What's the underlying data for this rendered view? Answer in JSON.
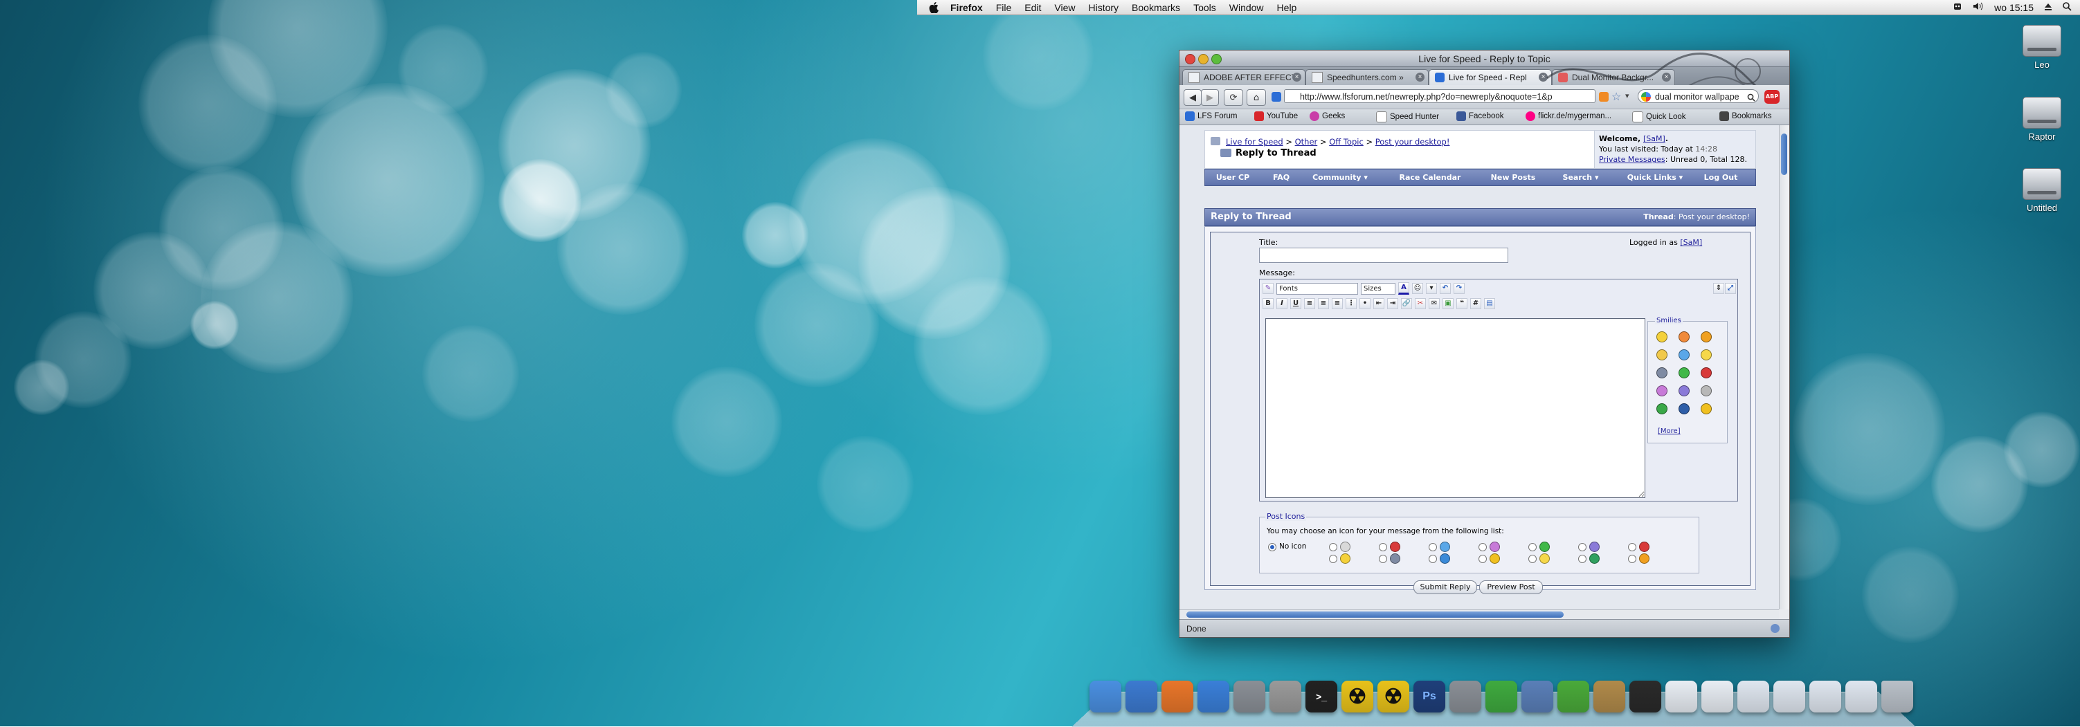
{
  "menubar": {
    "apple_icon": "apple-logo-icon",
    "app_name": "Firefox",
    "items": [
      "File",
      "Edit",
      "View",
      "History",
      "Bookmarks",
      "Tools",
      "Window",
      "Help"
    ],
    "clock": "wo 15:15"
  },
  "desktop_icons": [
    {
      "label": "Leo",
      "icon": "hard-drive-icon"
    },
    {
      "label": "Raptor",
      "icon": "hard-drive-icon"
    },
    {
      "label": "Untitled",
      "icon": "hard-drive-icon"
    }
  ],
  "window": {
    "title": "Live for Speed - Reply to Topic",
    "tabs": [
      {
        "label": "ADOBE AFTER EFFECT",
        "active": false,
        "icon": "page-icon"
      },
      {
        "label": "Speedhunters.com »",
        "active": false,
        "icon": "page-icon"
      },
      {
        "label": "Live for Speed - Repl",
        "active": true,
        "icon": "lfs-icon"
      },
      {
        "label": "Dual Monitor Backgr...",
        "active": false,
        "icon": "page-icon"
      }
    ],
    "url": "http://www.lfsforum.net/newreply.php?do=newreply&noquote=1&p",
    "search_value": "dual monitor wallpape",
    "bookmarks": [
      {
        "label": "LFS Forum",
        "icon": "lfs-icon",
        "color": "#2b6dd6"
      },
      {
        "label": "YouTube",
        "icon": "youtube-icon",
        "color": "#d8262a"
      },
      {
        "label": "Geeks",
        "icon": "geeks-icon",
        "color": "#c93ea8"
      },
      {
        "label": "Speed Hunter",
        "icon": "page-icon",
        "color": "#ffffff"
      },
      {
        "label": "Facebook",
        "icon": "facebook-icon",
        "color": "#3b5998"
      },
      {
        "label": "flickr.de/mygerman...",
        "icon": "flickr-icon",
        "color": "#ff0084"
      },
      {
        "label": "Quick Look",
        "icon": "page-icon",
        "color": "#ffffff"
      },
      {
        "label": "Bookmarks",
        "icon": "bookmarks-icon",
        "color": "#444444"
      }
    ],
    "status": "Done"
  },
  "forum": {
    "breadcrumb": [
      "Live for Speed",
      "Other",
      "Off Topic",
      "Post your desktop!"
    ],
    "page_title": "Reply to Thread",
    "welcome_prefix": "Welcome, ",
    "welcome_user": "[SaM]",
    "welcome_suffix": ".",
    "last_visited_label": "You last visited: Today at ",
    "last_visited_time": "14:28",
    "pm_label": "Private Messages",
    "pm_counts": ": Unread 0, Total 128.",
    "nav": [
      "User CP",
      "FAQ",
      "Community ▾",
      "Race Calendar",
      "New Posts",
      "Search ▾",
      "Quick Links ▾",
      "Log Out"
    ],
    "reply_header": "Reply to Thread",
    "thread_label": "Thread",
    "thread_title": ": Post your desktop!",
    "title_label": "Title:",
    "logged_in_label": "Logged in as ",
    "logged_in_user": "[SaM]",
    "message_label": "Message:",
    "title_value": "",
    "editor": {
      "fonts_label": "Fonts",
      "sizes_label": "Sizes",
      "bold": "B",
      "italic": "I",
      "underline": "U",
      "hash": "#"
    },
    "smilies_label": "Smilies",
    "smilies_more": "[More]",
    "smilie_colors": [
      "#f4d13a",
      "#f08a3a",
      "#f0a020",
      "#f1c94a",
      "#5aa7e8",
      "#f6d84a",
      "#7f8ba3",
      "#40b848",
      "#d83a3a",
      "#c77ad8",
      "#8a7ad8",
      "#b8b8b8",
      "#3aa848",
      "#2e5ea8",
      "#f0c020"
    ],
    "post_icons_label": "Post Icons",
    "post_icons_help": "You may choose an icon for your message from the following list:",
    "no_icon_label": "No icon",
    "post_icon_colors": [
      "#d9d9d9",
      "#d83a3a",
      "#5aa7e8",
      "#c77ad8",
      "#40b848",
      "#8a7ad8",
      "#d83a3a",
      "#f4d13a",
      "#7f8ba3",
      "#3a8ad8",
      "#f0c020",
      "#f6d84a",
      "#30a060",
      "#f0a020"
    ],
    "submit_label": "Submit Reply",
    "preview_label": "Preview Post"
  },
  "dock": {
    "items": [
      {
        "name": "finder-icon",
        "color": "#4a8fe0"
      },
      {
        "name": "safari-icon",
        "color": "#3c7ad0"
      },
      {
        "name": "firefox-icon",
        "color": "#e8762a"
      },
      {
        "name": "itunes-icon",
        "color": "#3a7fd8"
      },
      {
        "name": "system-preferences-icon",
        "color": "#8a8f96"
      },
      {
        "name": "utility-icon",
        "color": "#9a9a9a"
      },
      {
        "name": "terminal-icon",
        "color": "#222222"
      },
      {
        "name": "radiation-icon",
        "color": "#e8c21a"
      },
      {
        "name": "radiation-icon",
        "color": "#e8c21a"
      },
      {
        "name": "photoshop-icon",
        "color": "#1f3f7a"
      },
      {
        "name": "tools-icon",
        "color": "#8a8f96"
      },
      {
        "name": "adium-icon",
        "color": "#3faa3f"
      },
      {
        "name": "preview-icon",
        "color": "#5a7fb8"
      },
      {
        "name": "utorrent-icon",
        "color": "#4aaa3a"
      },
      {
        "name": "address-book-icon",
        "color": "#b08a4a"
      },
      {
        "name": "activity-monitor-icon",
        "color": "#2a2a2a"
      },
      {
        "name": "document-icon",
        "color": "#e8edf3"
      },
      {
        "name": "document-icon",
        "color": "#e8edf3"
      },
      {
        "name": "document-icon",
        "color": "#dfe6ef"
      },
      {
        "name": "document-icon",
        "color": "#dfe6ef"
      },
      {
        "name": "document-icon",
        "color": "#dfe6ef"
      },
      {
        "name": "document-icon",
        "color": "#dfe6ef"
      },
      {
        "name": "trash-icon",
        "color": "#b9c0c8"
      }
    ],
    "text_labels": {
      "photoshop": "Ps"
    }
  }
}
